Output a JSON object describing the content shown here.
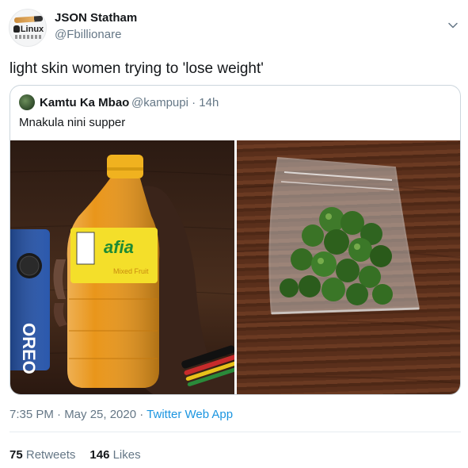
{
  "author": {
    "name": "JSON Statham",
    "handle": "@Fbillionare",
    "avatar_text": "Linux"
  },
  "tweet": {
    "text": "light skin women trying to 'lose weight'"
  },
  "quoted_tweet": {
    "name": "Kamtu Ka Mbao",
    "handle": "@kampupi",
    "time": "· 14h",
    "text": "Mnakula nini supper",
    "media": [
      {
        "icon": "photo-bottle-and-cookies",
        "bottle_brand": "afia",
        "bottle_flavor": "Mixed Fruit",
        "cookie_brand": "OREO"
      },
      {
        "icon": "photo-bag-of-peas"
      }
    ]
  },
  "footer": {
    "time": "7:35 PM · May 25, 2020 · ",
    "app": "Twitter Web App"
  },
  "stats": {
    "retweets_count": "75",
    "retweets_label": "Retweets",
    "likes_count": "146",
    "likes_label": "Likes"
  },
  "colors": {
    "link": "#1b95e0",
    "secondary_text": "#657786",
    "border": "#ccd6dd"
  }
}
